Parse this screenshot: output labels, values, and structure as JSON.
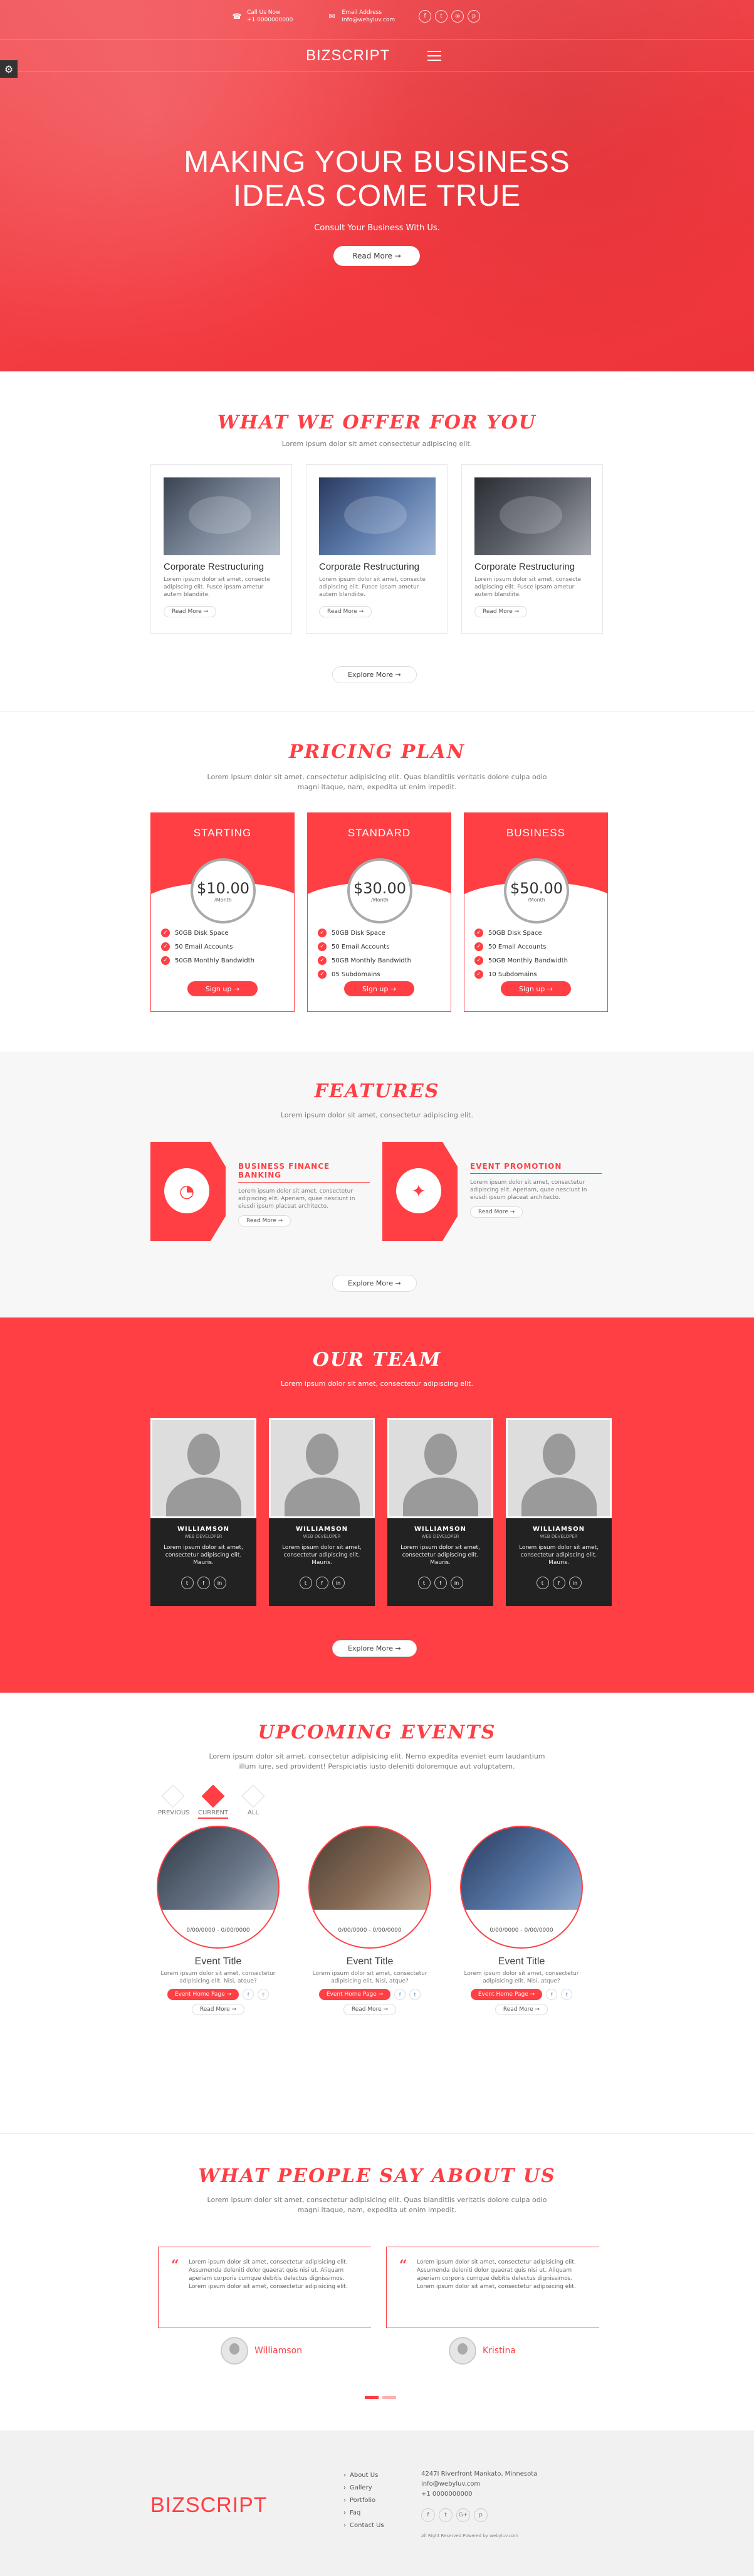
{
  "hero": {
    "call_label": "Call Us Now",
    "call_value": "+1 0000000000",
    "email_label": "Email Address",
    "email_value": "info@webyluv.com",
    "social_icons": [
      "facebook-icon",
      "twitter-icon",
      "instagram-icon",
      "pinterest-icon"
    ],
    "brand": "BIZSCRIPT",
    "title_line1": "MAKING YOUR BUSINESS",
    "title_line2": "IDEAS COME TRUE",
    "subtitle": "Consult Your Business With Us.",
    "button": "Read More →",
    "accent": "#ff3f44"
  },
  "offer": {
    "title": "What We Offer For You",
    "subtitle": "Lorem ipsum dolor sit amet consectetur adipiscing elit.",
    "cards": [
      {
        "title": "Corporate Restructuring",
        "text": "Lorem ipsum dolor sit amet, consecte adipiscing elit. Fusce ipsam ametur autem blandiite.",
        "button": "Read More →"
      },
      {
        "title": "Corporate Restructuring",
        "text": "Lorem ipsum dolor sit amet, consecte adipiscing elit. Fusce ipsam ametur autem blandiite.",
        "button": "Read More →"
      },
      {
        "title": "Corporate Restructuring",
        "text": "Lorem ipsum dolor sit amet, consecte adipiscing elit. Fusce ipsam ametur autem blandiite.",
        "button": "Read More →"
      }
    ],
    "explore": "Explore More →"
  },
  "pricing": {
    "title": "Pricing Plan",
    "subtitle": "Lorem ipsum dolor sit amet, consectetur adipisicing elit. Quas blanditiis veritatis dolore culpa odio magni itaque, nam, expedita ut enim impedit.",
    "plans": [
      {
        "name": "STARTING",
        "price": "$10.00",
        "period": "/Month",
        "features": [
          "50GB Disk Space",
          "50 Email Accounts",
          "50GB Monthly Bandwidth"
        ],
        "button": "Sign up →"
      },
      {
        "name": "STANDARD",
        "price": "$30.00",
        "period": "/Month",
        "features": [
          "50GB Disk Space",
          "50 Email Accounts",
          "50GB Monthly Bandwidth",
          "05 Subdomains"
        ],
        "button": "Sign up →"
      },
      {
        "name": "BUSINESS",
        "price": "$50.00",
        "period": "/Month",
        "features": [
          "50GB Disk Space",
          "50 Email Accounts",
          "50GB Monthly Bandwidth",
          "10 Subdomains"
        ],
        "button": "Sign up →"
      }
    ]
  },
  "features": {
    "title": "Features",
    "subtitle": "Lorem ipsum dolor sit amet, consectetur adipiscing elit.",
    "items": [
      {
        "title": "BUSINESS FINANCE BANKING",
        "text": "Lorem ipsum dolor sit amet, consectetur adipiscing elit. Aperiam, quae nesciunt in eiusdi ipsum placeat architecto.",
        "button": "Read More →",
        "icon": "finance-icon"
      },
      {
        "title": "EVENT PROMOTION",
        "text": "Lorem ipsum dolor sit amet, consectetur adipiscing elit. Aperiam, quae nesciunt in eiusdi ipsum placeat architecto.",
        "button": "Read More →",
        "icon": "promotion-icon"
      }
    ],
    "explore": "Explore More →"
  },
  "team": {
    "title": "Our Team",
    "subtitle": "Lorem ipsum dolor sit amet, consectetur adipiscing elit.",
    "members": [
      {
        "name": "WILLIAMSON",
        "role": "WEB DEVELOPER",
        "text": "Lorem ipsum dolor sit amet, consectetur adipiscing elit. Mauris."
      },
      {
        "name": "WILLIAMSON",
        "role": "WEB DEVELOPER",
        "text": "Lorem ipsum dolor sit amet, consectetur adipiscing elit. Mauris."
      },
      {
        "name": "WILLIAMSON",
        "role": "WEB DEVELOPER",
        "text": "Lorem ipsum dolor sit amet, consectetur adipiscing elit. Mauris."
      },
      {
        "name": "WILLIAMSON",
        "role": "WEB DEVELOPER",
        "text": "Lorem ipsum dolor sit amet, consectetur adipiscing elit. Mauris."
      }
    ],
    "explore": "Explore More →"
  },
  "events": {
    "title": "Upcoming Events",
    "subtitle": "Lorem ipsum dolor sit amet, consectetur adipisicing elit. Nemo expedita eveniet eum laudantium illum iure, sed provident! Perspiciatis iusto deleniti doloremque aut voluptatem.",
    "tabs": [
      "PREVIOUS",
      "CURRENT",
      "ALL"
    ],
    "cards": [
      {
        "date": "0/00/0000 - 0/00/0000",
        "title": "Event Title",
        "text": "Lorem ipsum dolor sit amet, consectetur adipisicing elit. Nisi, atque?",
        "button": "Event Home Page →",
        "more": "Read More →"
      },
      {
        "date": "0/00/0000 - 0/00/0000",
        "title": "Event Title",
        "text": "Lorem ipsum dolor sit amet, consectetur adipisicing elit. Nisi, atque?",
        "button": "Event Home Page →",
        "more": "Read More →"
      },
      {
        "date": "0/00/0000 - 0/00/0000",
        "title": "Event Title",
        "text": "Lorem ipsum dolor sit amet, consectetur adipisicing elit. Nisi, atque?",
        "button": "Event Home Page →",
        "more": "Read More →"
      }
    ]
  },
  "testimonials": {
    "title": "What People Say About Us",
    "subtitle": "Lorem ipsum dolor sit amet, consectetur adipisicing elit. Quas blanditiis veritatis dolore culpa odio magni itaque, nam, expedita ut enim impedit.",
    "quotes": [
      {
        "text": "Lorem ipsum dolor sit amet, consectetur adipisicing elit. Assumenda deleniti dolor quaerat quis nisi ut. Aliquam aperiam corporis cumque debitis delectus dignissimos. Lorem ipsum dolor sit amet, consectetur adipisicing elit.",
        "name": "Williamson"
      },
      {
        "text": "Lorem ipsum dolor sit amet, consectetur adipisicing elit. Assumenda deleniti dolor quaerat quis nisi ut. Aliquam aperiam corporis cumque debitis delectus dignissimos. Lorem ipsum dolor sit amet, consectetur adipisicing elit.",
        "name": "Kristina"
      }
    ]
  },
  "footer": {
    "brand": "BIZSCRIPT",
    "links": [
      "About Us",
      "Gallery",
      "Portfolio",
      "Faq",
      "Contact Us"
    ],
    "address": "4247I Riverfront Mankato, Minnesota",
    "email": "info@webyluv.com",
    "phone": "+1 0000000000",
    "copyright": "All Right Reserved Powered by webyluv.com"
  }
}
